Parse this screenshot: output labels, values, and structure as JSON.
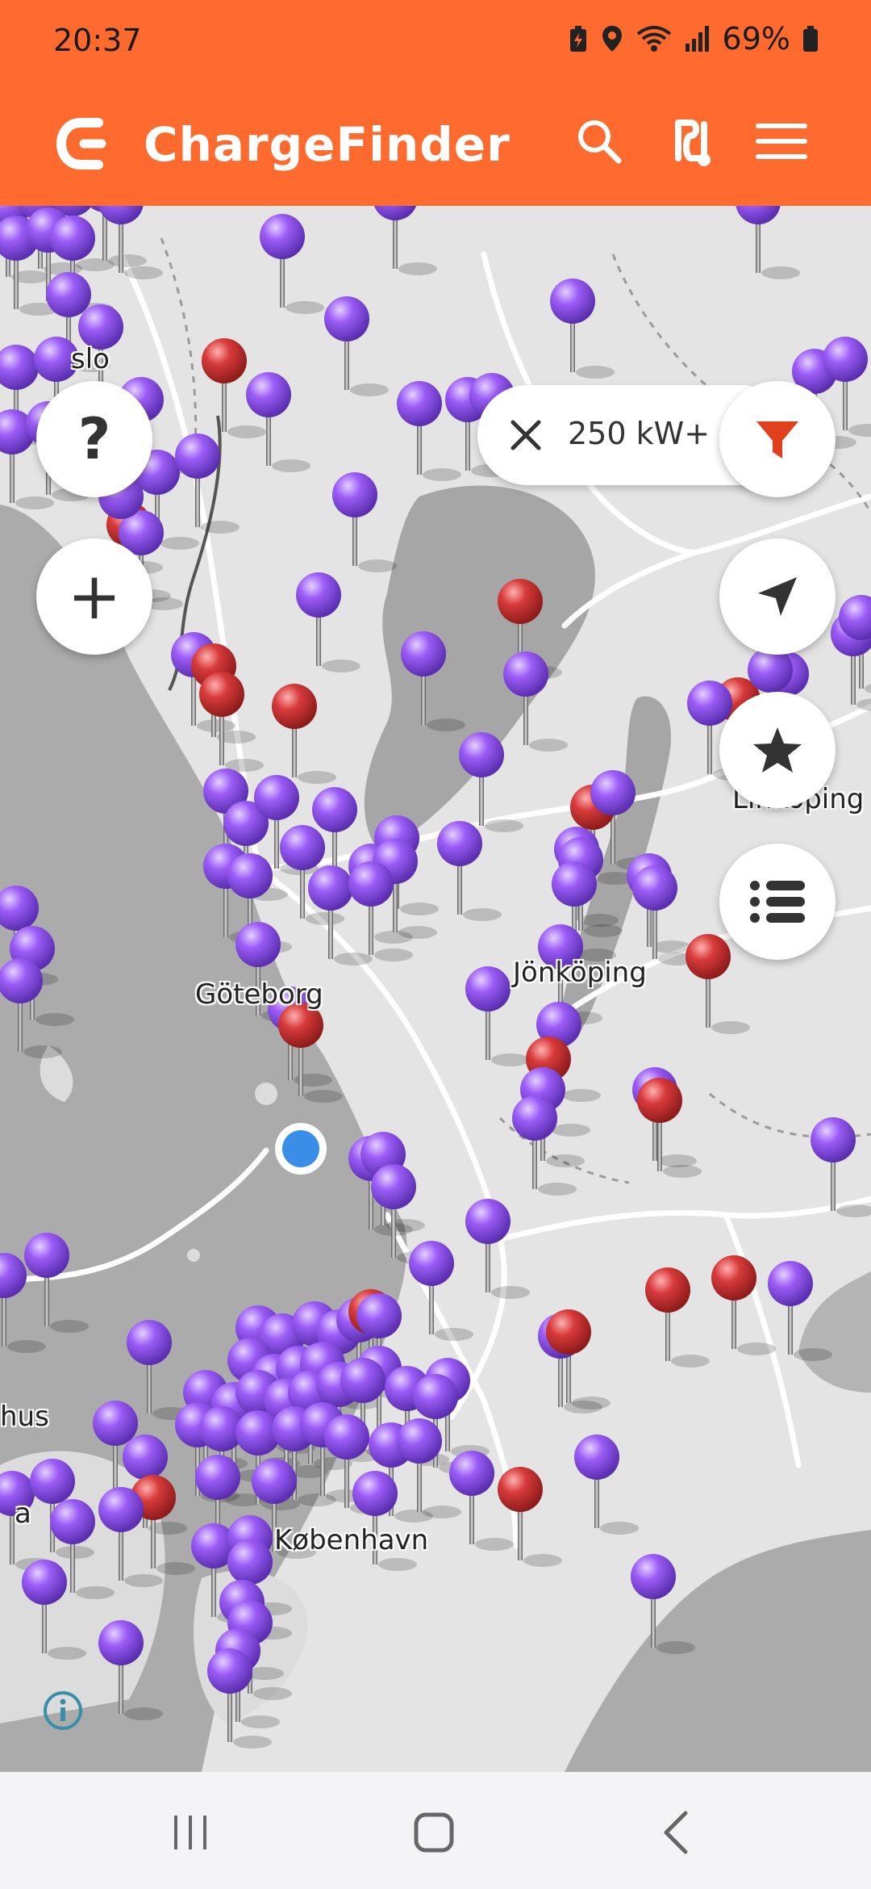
{
  "status_bar": {
    "time": "20:37",
    "battery_percent": "69%",
    "icons": [
      "battery-saver-icon",
      "location-icon",
      "wifi-icon",
      "signal-icon",
      "battery-icon"
    ]
  },
  "app_bar": {
    "title": "ChargeFinder",
    "actions": [
      "search-icon",
      "route-icon",
      "menu-icon"
    ]
  },
  "filter_chip": {
    "label": "250 kW+",
    "active": true
  },
  "map": {
    "cities": [
      "Göteborg",
      "Jönköping",
      "Linköping",
      "København"
    ],
    "partial_labels": [
      "slo",
      "hus",
      "a"
    ],
    "colors": {
      "standard_station": "#9b5cf6",
      "fast_station": "#d83a3a",
      "user_location": "#3b8ee8"
    }
  },
  "controls": {
    "help_label": "?",
    "zoom_in_label": "+",
    "buttons": [
      "filter-icon",
      "locate-icon",
      "favorites-icon",
      "list-icon"
    ]
  },
  "nav_bar": [
    "recents-button",
    "home-button",
    "back-button"
  ]
}
